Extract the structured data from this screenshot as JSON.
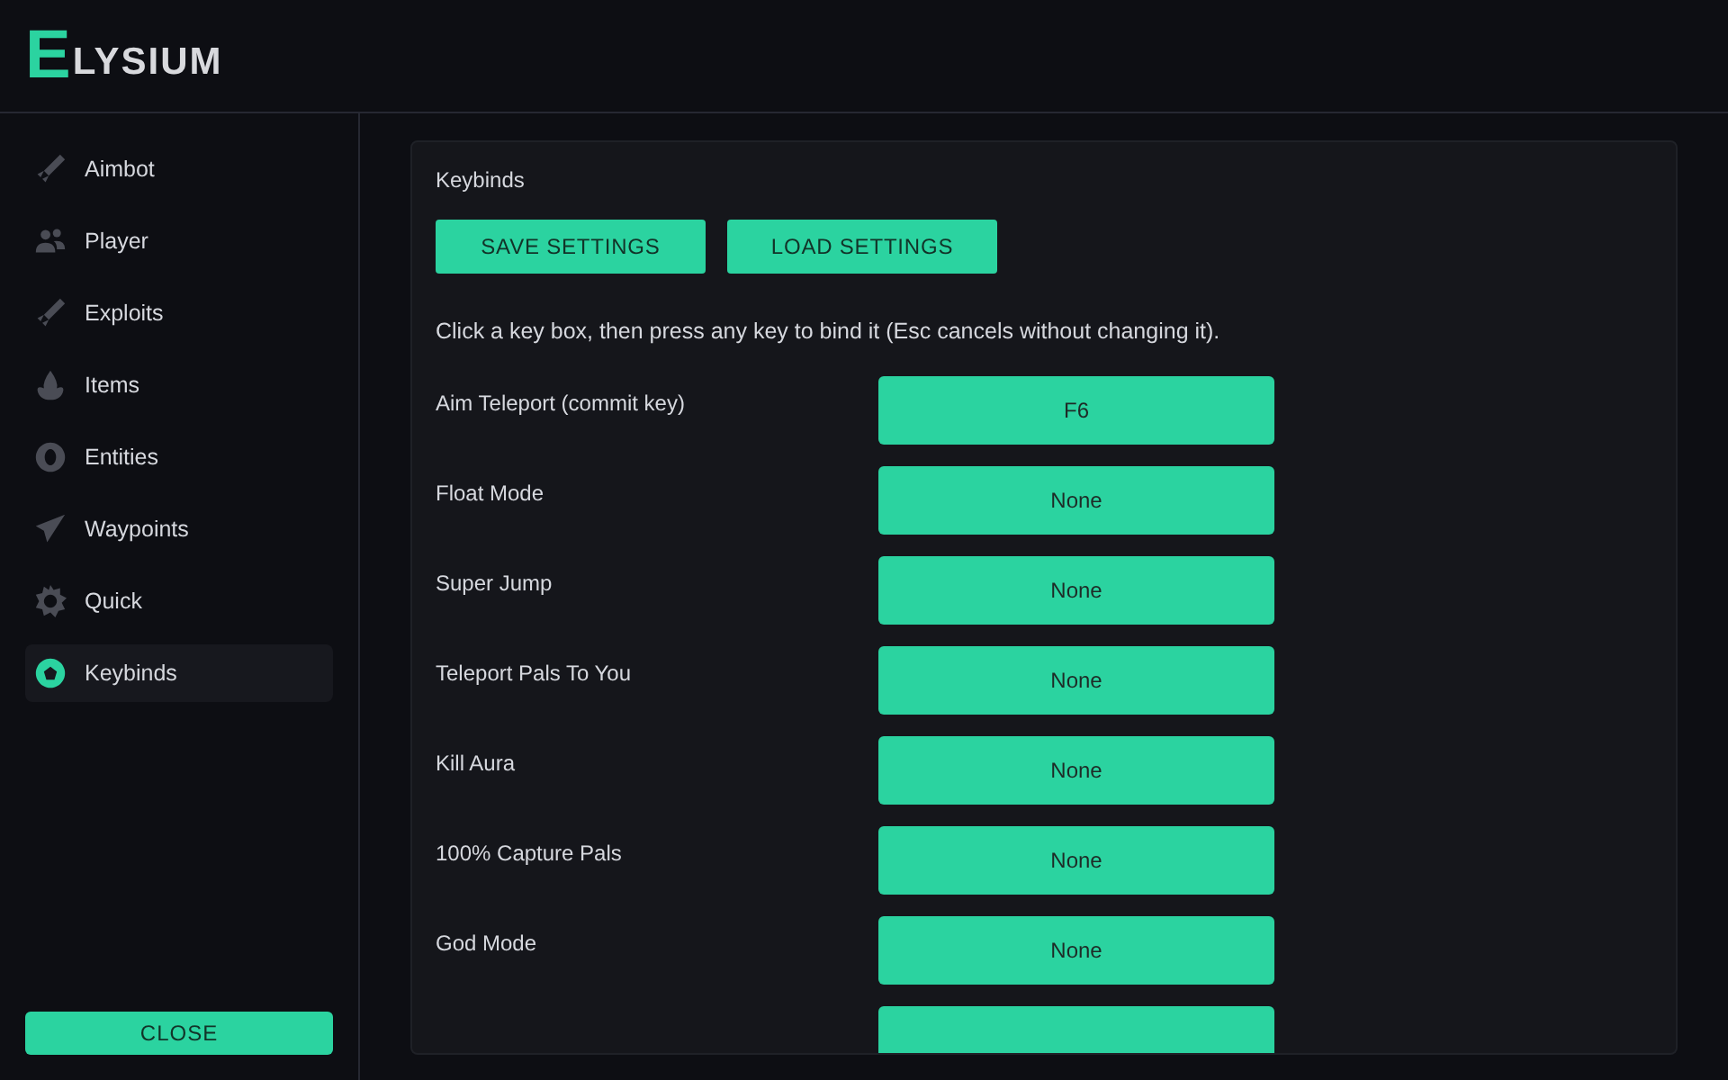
{
  "logo": {
    "letter": "E",
    "text": "LYSIUM"
  },
  "sidebar": {
    "items": [
      {
        "label": "Aimbot",
        "selected": false
      },
      {
        "label": "Player",
        "selected": false
      },
      {
        "label": "Exploits",
        "selected": false
      },
      {
        "label": "Items",
        "selected": false
      },
      {
        "label": "Entities",
        "selected": false
      },
      {
        "label": "Waypoints",
        "selected": false
      },
      {
        "label": "Quick",
        "selected": false
      },
      {
        "label": "Keybinds",
        "selected": true
      }
    ],
    "close_button": "CLOSE"
  },
  "panel": {
    "title": "Keybinds",
    "buttons": [
      "SAVE SETTINGS",
      "LOAD SETTINGS"
    ],
    "hint": "Click a key box, then press any key to bind it (Esc cancels without changing it).",
    "binds": [
      {
        "label": "Aim Teleport (commit key)",
        "key": "F6"
      },
      {
        "label": "Float Mode",
        "key": "None"
      },
      {
        "label": "Super Jump",
        "key": "None"
      },
      {
        "label": "Teleport Pals To You",
        "key": "None"
      },
      {
        "label": "Kill Aura",
        "key": "None"
      },
      {
        "label": "100% Capture Pals",
        "key": "None"
      },
      {
        "label": "God Mode",
        "key": "None"
      }
    ],
    "more_rows_cut_off": true
  }
}
